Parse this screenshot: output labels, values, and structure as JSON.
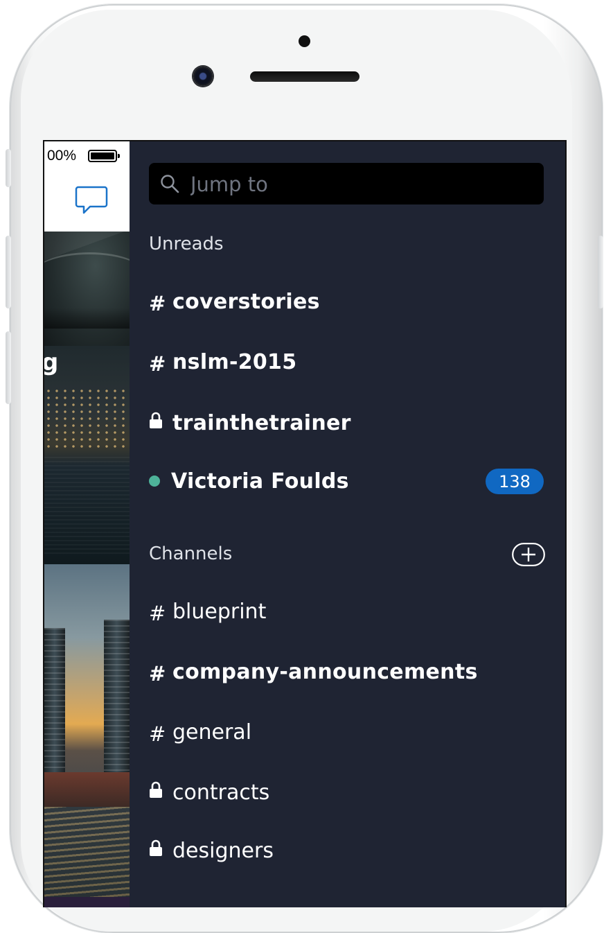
{
  "status": {
    "battery_percent": "00%"
  },
  "search": {
    "placeholder": "Jump to"
  },
  "unreads": {
    "label": "Unreads",
    "items": [
      {
        "name": "coverstories",
        "kind": "public"
      },
      {
        "name": "nslm-2015",
        "kind": "public"
      },
      {
        "name": "trainthetrainer",
        "kind": "private"
      },
      {
        "name": "Victoria Foulds",
        "kind": "dm",
        "badge": "138"
      }
    ]
  },
  "channels": {
    "label": "Channels",
    "items": [
      {
        "name": "blueprint",
        "kind": "public"
      },
      {
        "name": "company-announcements",
        "kind": "public",
        "unread": true
      },
      {
        "name": "general",
        "kind": "public"
      },
      {
        "name": "contracts",
        "kind": "private"
      },
      {
        "name": "designers",
        "kind": "private"
      }
    ]
  },
  "colors": {
    "sidebar_bg": "#1f2433",
    "badge_bg": "#1068c2",
    "presence_online": "#4eb39a",
    "accent_icon": "#1a73c9"
  },
  "icons": {
    "search": "search-icon",
    "chat": "chat-bubble-icon",
    "lock": "lock-icon",
    "hash": "hash-icon",
    "add": "add-circle-icon",
    "presence": "presence-dot-icon"
  },
  "peek": {
    "partial_glyph": "g"
  }
}
